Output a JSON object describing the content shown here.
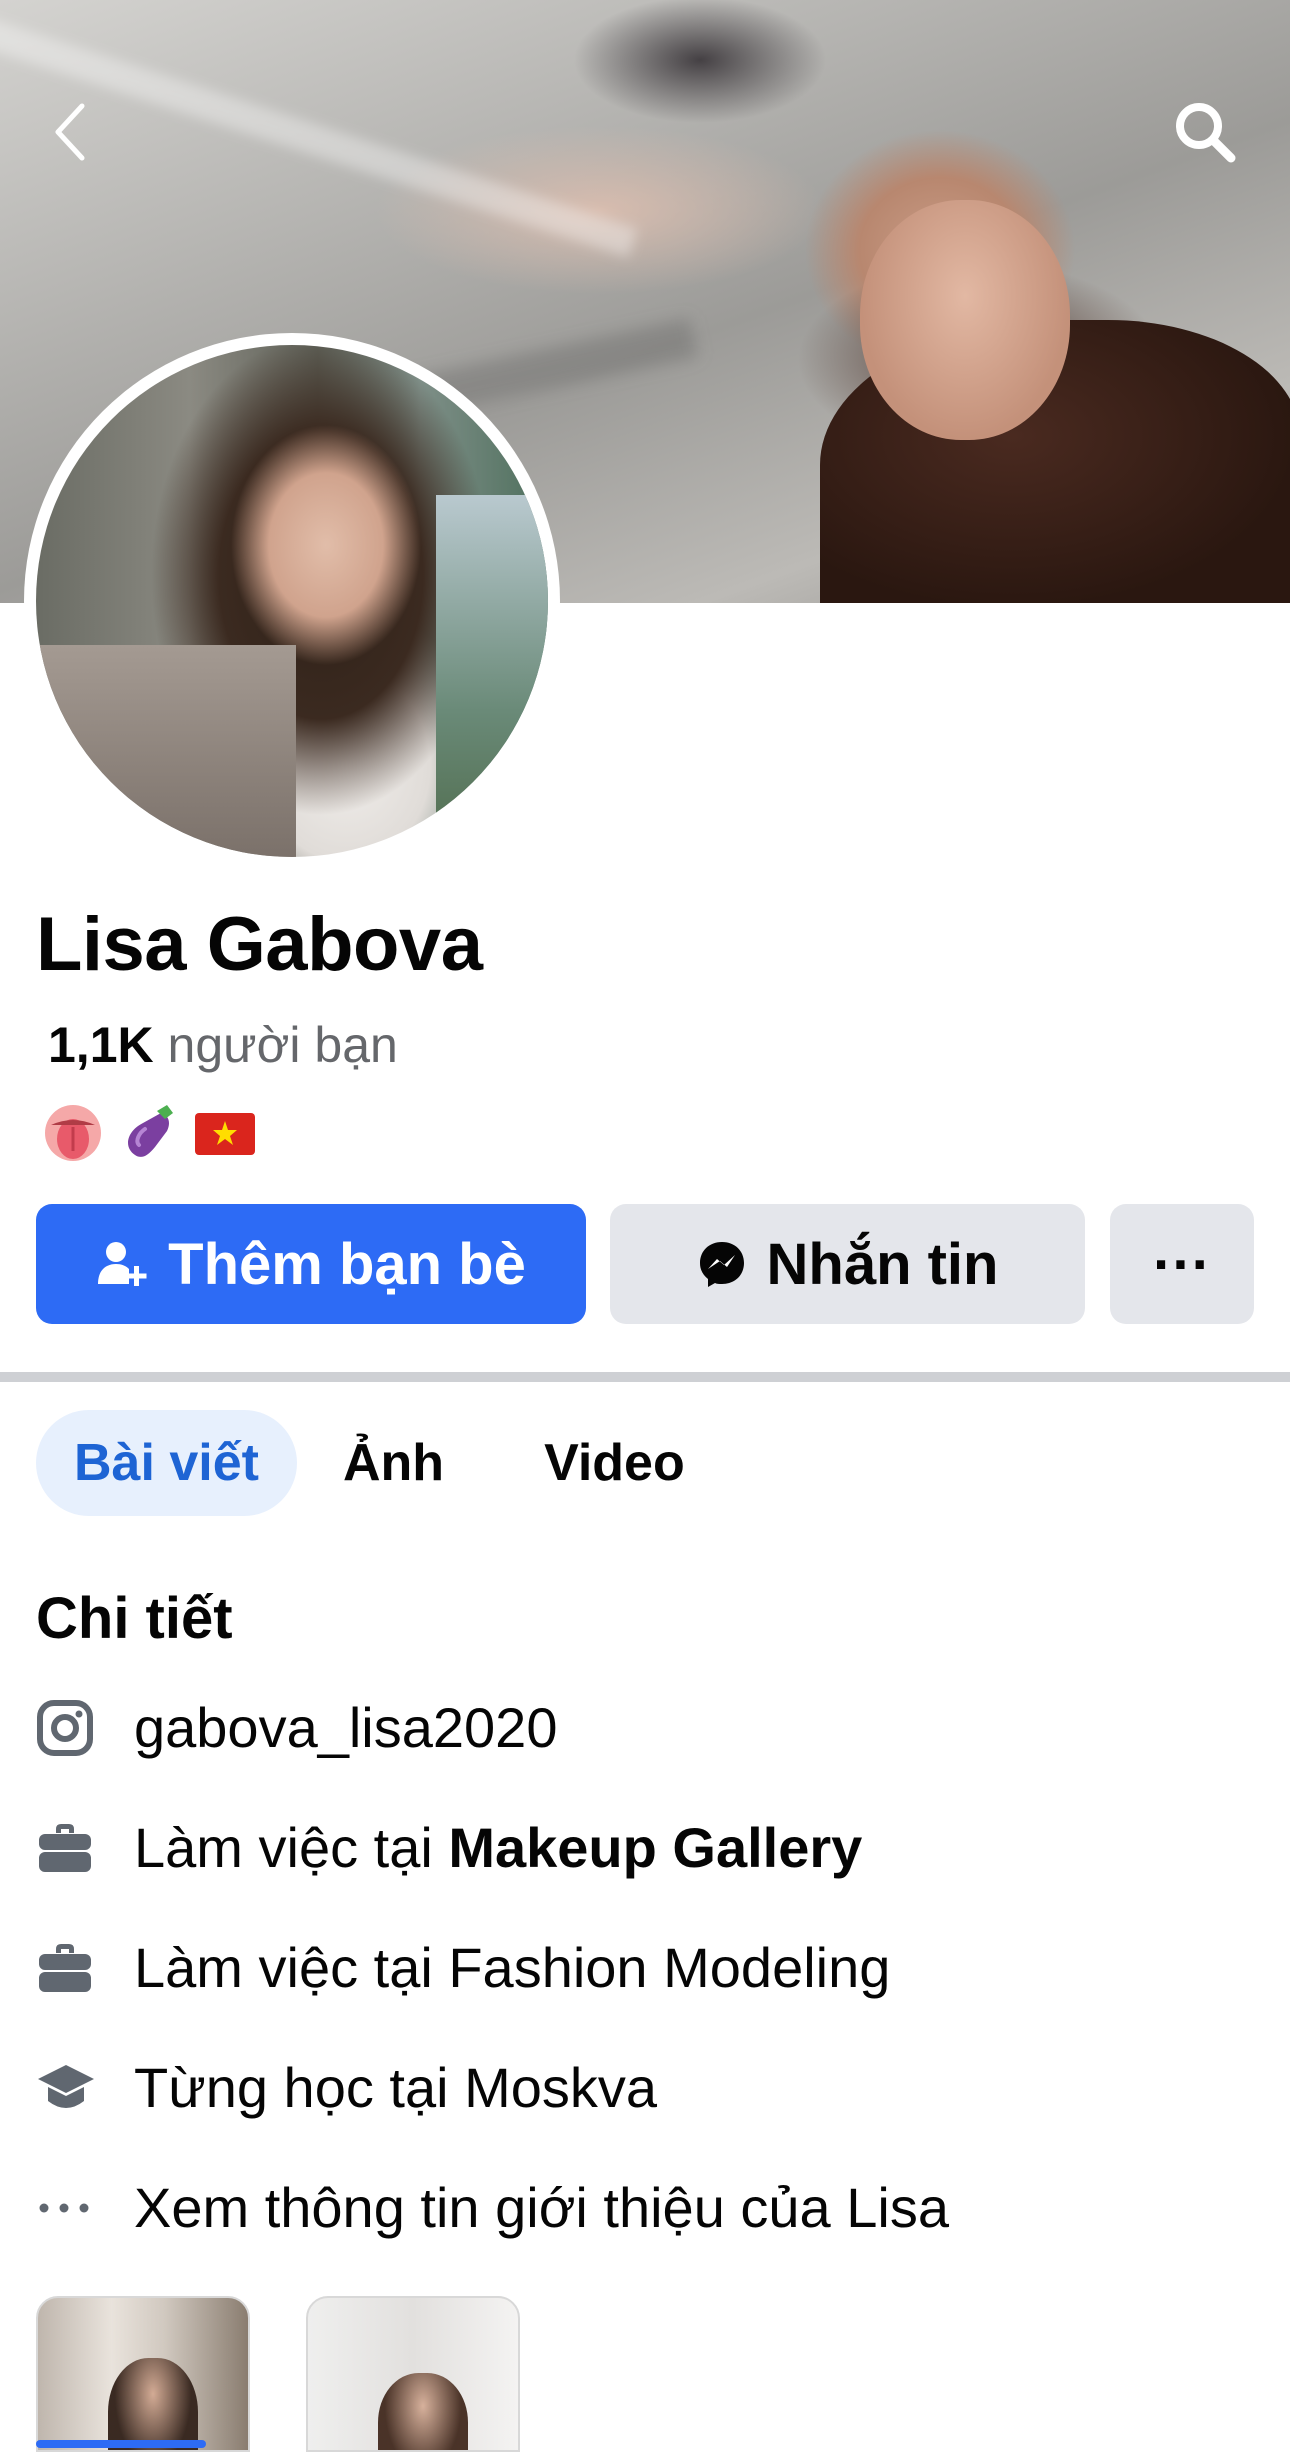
{
  "header": {
    "back_icon": "chevron-left-icon",
    "search_icon": "search-icon"
  },
  "profile": {
    "name": "Lisa Gabova",
    "friends_count": "1,1K",
    "friends_label": "người bạn",
    "bio_emojis": [
      "tongue-emoji",
      "eggplant-emoji",
      "vietnam-flag-emoji"
    ]
  },
  "actions": {
    "add_friend": "Thêm bạn bè",
    "message": "Nhắn tin",
    "more": "···",
    "primary_color": "#2d6bf5"
  },
  "tabs": [
    {
      "label": "Bài viết",
      "active": true
    },
    {
      "label": "Ảnh",
      "active": false
    },
    {
      "label": "Video",
      "active": false
    }
  ],
  "details": {
    "title": "Chi tiết",
    "items": [
      {
        "icon": "instagram-icon",
        "text": "gabova_lisa2020"
      },
      {
        "icon": "briefcase-icon",
        "prefix": "Làm việc tại ",
        "bold": "Makeup Gallery"
      },
      {
        "icon": "briefcase-icon",
        "text": "Làm việc tại Fashion Modeling"
      },
      {
        "icon": "graduation-cap-icon",
        "text": "Từng học tại Moskva"
      },
      {
        "icon": "more-dots-icon",
        "text": "Xem thông tin giới thiệu của Lisa"
      }
    ]
  }
}
